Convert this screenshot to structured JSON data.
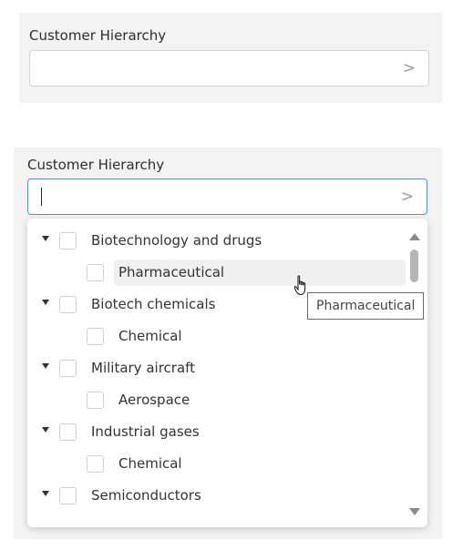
{
  "top_field": {
    "label": "Customer Hierarchy",
    "value": "",
    "chevron": ">"
  },
  "bottom_field": {
    "label": "Customer Hierarchy",
    "value": "",
    "chevron": ">"
  },
  "tree": {
    "items": [
      {
        "label": "Biotechnology and drugs",
        "level": 0,
        "expanded": true
      },
      {
        "label": "Pharmaceutical",
        "level": 1,
        "hovered": true
      },
      {
        "label": "Biotech chemicals",
        "level": 0,
        "expanded": true
      },
      {
        "label": "Chemical",
        "level": 1
      },
      {
        "label": "Military aircraft",
        "level": 0,
        "expanded": true
      },
      {
        "label": "Aerospace",
        "level": 1
      },
      {
        "label": "Industrial gases",
        "level": 0,
        "expanded": true
      },
      {
        "label": "Chemical",
        "level": 1
      },
      {
        "label": "Semiconductors",
        "level": 0,
        "expanded": true
      }
    ]
  },
  "tooltip": {
    "text": "Pharmaceutical"
  },
  "colors": {
    "panel_bg": "#f3f3f3",
    "focus_border": "#5a8fd8",
    "hover_bg": "#f0f0f0"
  }
}
